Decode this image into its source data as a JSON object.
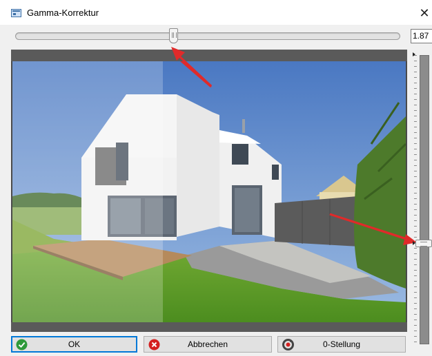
{
  "window": {
    "title": "Gamma-Korrektur",
    "close_glyph": "✕"
  },
  "gamma": {
    "value_text": "1.87",
    "slider_fraction": 0.41
  },
  "vertical_slider": {
    "fraction": 0.65
  },
  "buttons": {
    "ok": {
      "label": "OK",
      "icon": "check-circle-icon"
    },
    "cancel": {
      "label": "Abbrechen",
      "icon": "cancel-circle-icon"
    },
    "reset": {
      "label": "0-Stellung",
      "icon": "reset-circle-icon"
    }
  },
  "colors": {
    "annotation_arrow": "#e02a2a",
    "ok_icon": "#2e9a3a",
    "cancel_icon": "#d42020",
    "focus_border": "#0078d7"
  }
}
